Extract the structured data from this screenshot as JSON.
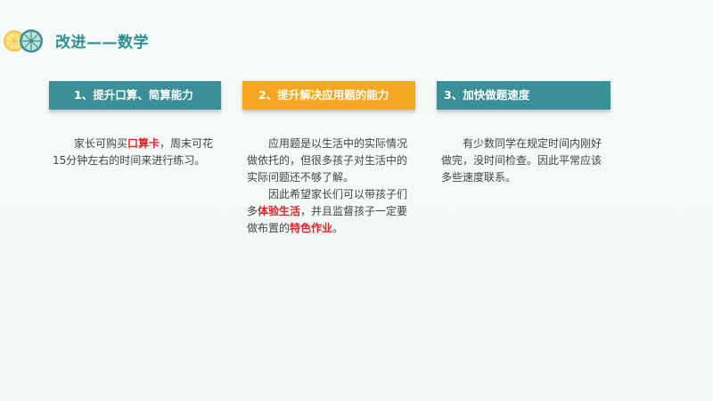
{
  "title": "改进——数学",
  "colors": {
    "teal": "#3b8f96",
    "orange": "#f5a623",
    "highlight": "#e8202a",
    "title": "#2f8e93"
  },
  "logo": {
    "icon": "citrus-slices-icon"
  },
  "sections": [
    {
      "header": "1、提升口算、简算能力",
      "paragraphs": [
        {
          "before": "家长可购买",
          "highlight": "口算卡",
          "after": "，周末可花15分钟左右的时间来进行练习。"
        }
      ]
    },
    {
      "header": "2、提升解决应用题的能力",
      "paragraphs": [
        {
          "text": "应用题是以生活中的实际情况做依托的，但很多孩子对生活中的实际问题还不够了解。"
        },
        {
          "before": "因此希望家长们可以带孩子们多",
          "highlight": "体验生活",
          "middle": "，并且监督孩子一定要做布置的",
          "highlight2": "特色作业",
          "after": "。"
        }
      ]
    },
    {
      "header": "3、加快做题速度",
      "paragraphs": [
        {
          "text": "有少数同学在规定时间内刚好做完，没时间检查。因此平常应该多些速度联系。"
        }
      ]
    }
  ]
}
